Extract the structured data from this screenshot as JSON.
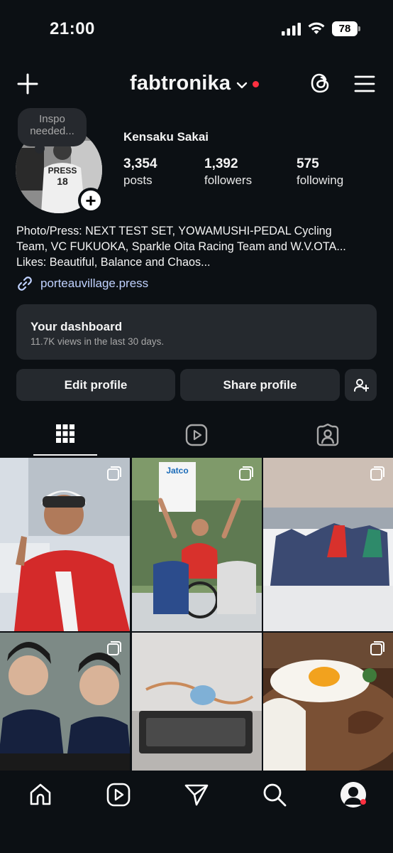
{
  "status_bar": {
    "time": "21:00",
    "battery": "78"
  },
  "header": {
    "username": "fabtronika"
  },
  "profile": {
    "note": "Inspo needed...",
    "display_name": "Kensaku Sakai",
    "stats": [
      {
        "value": "3,354",
        "label": "posts"
      },
      {
        "value": "1,392",
        "label": "followers"
      },
      {
        "value": "575",
        "label": "following"
      }
    ],
    "bio_lines": [
      "Photo/Press: NEXT TEST SET, YOWAMUSHI-PEDAL Cycling",
      "Team, VC FUKUOKA, Sparkle Oita Racing Team and W.V.OTA...",
      "Likes: Beautiful, Balance and Chaos..."
    ],
    "link": "porteauvillage.press"
  },
  "dashboard": {
    "title": "Your dashboard",
    "subtitle": "11.7K views in the last 30 days."
  },
  "buttons": {
    "edit": "Edit profile",
    "share": "Share profile"
  },
  "tabs": [
    "grid-icon",
    "reels-icon",
    "tagged-icon"
  ],
  "grid": [
    {
      "name": "post-cyclist-portrait",
      "caption": ""
    },
    {
      "name": "post-race-finish",
      "caption": "Jatco"
    },
    {
      "name": "post-peloton",
      "caption": ""
    },
    {
      "name": "post-two-riders",
      "caption": ""
    },
    {
      "name": "post-earphones",
      "caption": ""
    },
    {
      "name": "post-fried-egg-rice",
      "caption": ""
    }
  ],
  "bottom_nav": [
    "home-icon",
    "reels-icon",
    "send-icon",
    "search-icon",
    "profile-icon"
  ]
}
